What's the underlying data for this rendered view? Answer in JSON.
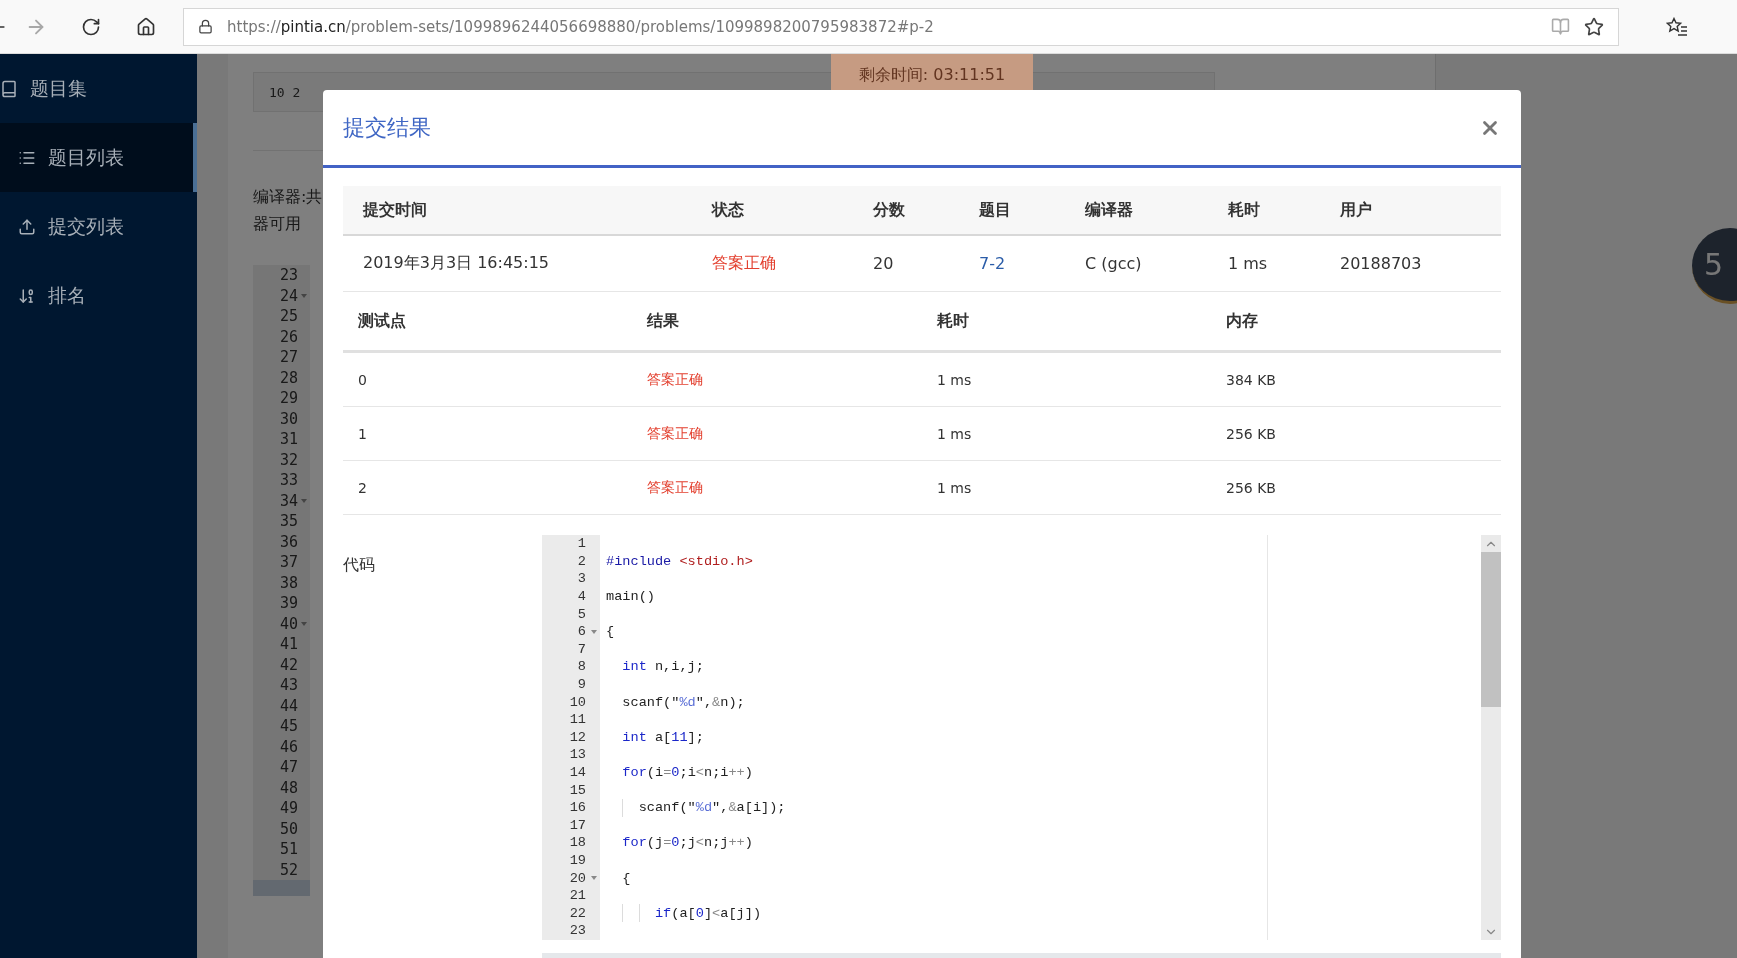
{
  "browser": {
    "address": {
      "scheme": "https://",
      "host": "pintia.cn",
      "path": "/problem-sets/1099896244056698880/problems/1099898200795983872#p-2"
    }
  },
  "sidebar": {
    "items": [
      {
        "label": "题目集",
        "kind": "group",
        "selected": false
      },
      {
        "label": "题目列表",
        "kind": "link",
        "selected": true
      },
      {
        "label": "提交列表",
        "kind": "link",
        "selected": false
      },
      {
        "label": "排名",
        "kind": "link",
        "selected": false
      }
    ]
  },
  "background": {
    "sample_input": "10 2",
    "timer": "剩余时间: 03:11:51",
    "compiler_note": [
      "编译器:共",
      "器可用"
    ],
    "badge": "5",
    "line_numbers": [
      {
        "number": "23",
        "fold": false
      },
      {
        "number": "24",
        "fold": true
      },
      {
        "number": "25",
        "fold": false
      },
      {
        "number": "26",
        "fold": false
      },
      {
        "number": "27",
        "fold": false
      },
      {
        "number": "28",
        "fold": false
      },
      {
        "number": "29",
        "fold": false
      },
      {
        "number": "30",
        "fold": false
      },
      {
        "number": "31",
        "fold": false
      },
      {
        "number": "32",
        "fold": false
      },
      {
        "number": "33",
        "fold": false
      },
      {
        "number": "34",
        "fold": true
      },
      {
        "number": "35",
        "fold": false
      },
      {
        "number": "36",
        "fold": false
      },
      {
        "number": "37",
        "fold": false
      },
      {
        "number": "38",
        "fold": false
      },
      {
        "number": "39",
        "fold": false
      },
      {
        "number": "40",
        "fold": true
      },
      {
        "number": "41",
        "fold": false
      },
      {
        "number": "42",
        "fold": false
      },
      {
        "number": "43",
        "fold": false
      },
      {
        "number": "44",
        "fold": false
      },
      {
        "number": "45",
        "fold": false
      },
      {
        "number": "46",
        "fold": false
      },
      {
        "number": "47",
        "fold": false
      },
      {
        "number": "48",
        "fold": false
      },
      {
        "number": "49",
        "fold": false
      },
      {
        "number": "50",
        "fold": false
      },
      {
        "number": "51",
        "fold": false
      },
      {
        "number": "52",
        "fold": false
      }
    ]
  },
  "modal": {
    "title": "提交结果",
    "summary": {
      "columns": [
        "提交时间",
        "状态",
        "分数",
        "题目",
        "编译器",
        "耗时",
        "用户"
      ],
      "row": [
        {
          "text": "2019年3月3日 16:45:15",
          "kind": "text"
        },
        {
          "text": "答案正确",
          "kind": "status"
        },
        {
          "text": "20",
          "kind": "text"
        },
        {
          "text": "7-2",
          "kind": "link"
        },
        {
          "text": "C (gcc)",
          "kind": "text"
        },
        {
          "text": "1 ms",
          "kind": "text"
        },
        {
          "text": "20188703",
          "kind": "text"
        }
      ]
    },
    "tests": {
      "columns": [
        "测试点",
        "结果",
        "耗时",
        "内存"
      ],
      "rows": [
        {
          "cells": [
            {
              "text": "0",
              "kind": "text"
            },
            {
              "text": "答案正确",
              "kind": "status"
            },
            {
              "text": "1 ms",
              "kind": "text"
            },
            {
              "text": "384 KB",
              "kind": "text"
            }
          ]
        },
        {
          "cells": [
            {
              "text": "1",
              "kind": "text"
            },
            {
              "text": "答案正确",
              "kind": "status"
            },
            {
              "text": "1 ms",
              "kind": "text"
            },
            {
              "text": "256 KB",
              "kind": "text"
            }
          ]
        },
        {
          "cells": [
            {
              "text": "2",
              "kind": "text"
            },
            {
              "text": "答案正确",
              "kind": "status"
            },
            {
              "text": "1 ms",
              "kind": "text"
            },
            {
              "text": "256 KB",
              "kind": "text"
            }
          ]
        }
      ]
    },
    "code": {
      "label": "代码",
      "lines": [
        {
          "number": "1",
          "fold": false
        },
        {
          "number": "2",
          "fold": false,
          "tokens": [
            {
              "text": "#include",
              "kind": "preproc"
            },
            {
              "text": " <stdio.h>",
              "kind": "header"
            }
          ]
        },
        {
          "number": "3",
          "fold": false
        },
        {
          "number": "4",
          "fold": false,
          "tokens": [
            {
              "text": "main()",
              "kind": "plain"
            }
          ]
        },
        {
          "number": "5",
          "fold": false
        },
        {
          "number": "6",
          "fold": true,
          "tokens": [
            {
              "text": "{",
              "kind": "plain"
            }
          ]
        },
        {
          "number": "7",
          "fold": false
        },
        {
          "number": "8",
          "fold": false,
          "tokens": [
            {
              "text": "  int",
              "kind": "keyword"
            },
            {
              "text": " n,i,j;",
              "kind": "plain"
            }
          ]
        },
        {
          "number": "9",
          "fold": false
        },
        {
          "number": "10",
          "fold": false,
          "tokens": [
            {
              "text": "  scanf(\"",
              "kind": "plain"
            },
            {
              "text": "%d",
              "kind": "format"
            },
            {
              "text": "\",",
              "kind": "plain"
            },
            {
              "text": "&",
              "kind": "operator"
            },
            {
              "text": "n);",
              "kind": "plain"
            }
          ]
        },
        {
          "number": "11",
          "fold": false
        },
        {
          "number": "12",
          "fold": false,
          "tokens": [
            {
              "text": "  int",
              "kind": "keyword"
            },
            {
              "text": " a[",
              "kind": "plain"
            },
            {
              "text": "11",
              "kind": "number"
            },
            {
              "text": "];",
              "kind": "plain"
            }
          ]
        },
        {
          "number": "13",
          "fold": false
        },
        {
          "number": "14",
          "fold": false,
          "tokens": [
            {
              "text": "  for",
              "kind": "keyword"
            },
            {
              "text": "(i",
              "kind": "plain"
            },
            {
              "text": "=",
              "kind": "operator"
            },
            {
              "text": "0",
              "kind": "number"
            },
            {
              "text": ";i",
              "kind": "plain"
            },
            {
              "text": "<",
              "kind": "operator"
            },
            {
              "text": "n;i",
              "kind": "plain"
            },
            {
              "text": "++",
              "kind": "operator"
            },
            {
              "text": ")",
              "kind": "plain"
            }
          ]
        },
        {
          "number": "15",
          "fold": false
        },
        {
          "number": "16",
          "fold": false,
          "tokens": [
            {
              "text": "    scanf(\"",
              "kind": "plain"
            },
            {
              "text": "%d",
              "kind": "format"
            },
            {
              "text": "\",",
              "kind": "plain"
            },
            {
              "text": "&",
              "kind": "operator"
            },
            {
              "text": "a[i]);",
              "kind": "plain"
            }
          ]
        },
        {
          "number": "17",
          "fold": false
        },
        {
          "number": "18",
          "fold": false,
          "tokens": [
            {
              "text": "  for",
              "kind": "keyword"
            },
            {
              "text": "(j",
              "kind": "plain"
            },
            {
              "text": "=",
              "kind": "operator"
            },
            {
              "text": "0",
              "kind": "number"
            },
            {
              "text": ";j",
              "kind": "plain"
            },
            {
              "text": "<",
              "kind": "operator"
            },
            {
              "text": "n;j",
              "kind": "plain"
            },
            {
              "text": "++",
              "kind": "operator"
            },
            {
              "text": ")",
              "kind": "plain"
            }
          ]
        },
        {
          "number": "19",
          "fold": false
        },
        {
          "number": "20",
          "fold": true,
          "tokens": [
            {
              "text": "  {",
              "kind": "plain"
            }
          ]
        },
        {
          "number": "21",
          "fold": false
        },
        {
          "number": "22",
          "fold": false,
          "tokens": [
            {
              "text": "      if",
              "kind": "keyword"
            },
            {
              "text": "(a[",
              "kind": "plain"
            },
            {
              "text": "0",
              "kind": "number"
            },
            {
              "text": "]",
              "kind": "plain"
            },
            {
              "text": "<",
              "kind": "operator"
            },
            {
              "text": "a[j])",
              "kind": "plain"
            }
          ]
        },
        {
          "number": "23",
          "fold": false
        }
      ]
    }
  }
}
